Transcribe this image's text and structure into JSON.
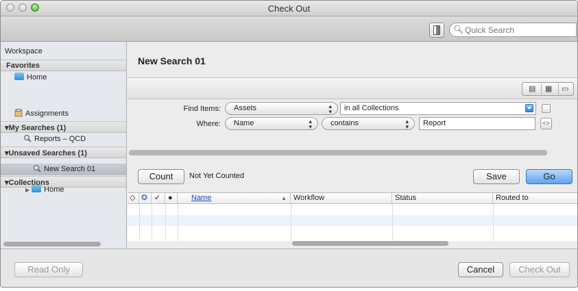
{
  "window": {
    "title": "Check Out"
  },
  "toolbar": {
    "search_placeholder": "Quick Search"
  },
  "sidebar": {
    "workspace_label": "Workspace",
    "favorites_header": "Favorites",
    "favorites": [
      {
        "label": "Home"
      }
    ],
    "assignments_label": "Assignments",
    "my_searches_header": "My Searches (1)",
    "my_searches": [
      {
        "label": "Reports – QCD"
      }
    ],
    "unsaved_searches_header": "Unsaved Searches (1)",
    "unsaved_searches": [
      {
        "label": "New Search 01"
      }
    ],
    "collections_header": "Collections",
    "collections": [
      {
        "label": "Home"
      }
    ]
  },
  "search": {
    "title": "New Search 01",
    "find_items_label": "Find Items:",
    "find_items_value": "Assets",
    "scope_value": "in all Collections",
    "where_label": "Where:",
    "field_value": "Name",
    "operator_value": "contains",
    "query_value": "Report"
  },
  "count_bar": {
    "count_label": "Count",
    "status": "Not Yet Counted",
    "save_label": "Save",
    "go_label": "Go"
  },
  "table": {
    "columns": [
      "Name",
      "Workflow",
      "Status",
      "Routed to"
    ],
    "rows": []
  },
  "footer": {
    "read_only_label": "Read Only",
    "cancel_label": "Cancel",
    "check_out_label": "Check Out"
  }
}
